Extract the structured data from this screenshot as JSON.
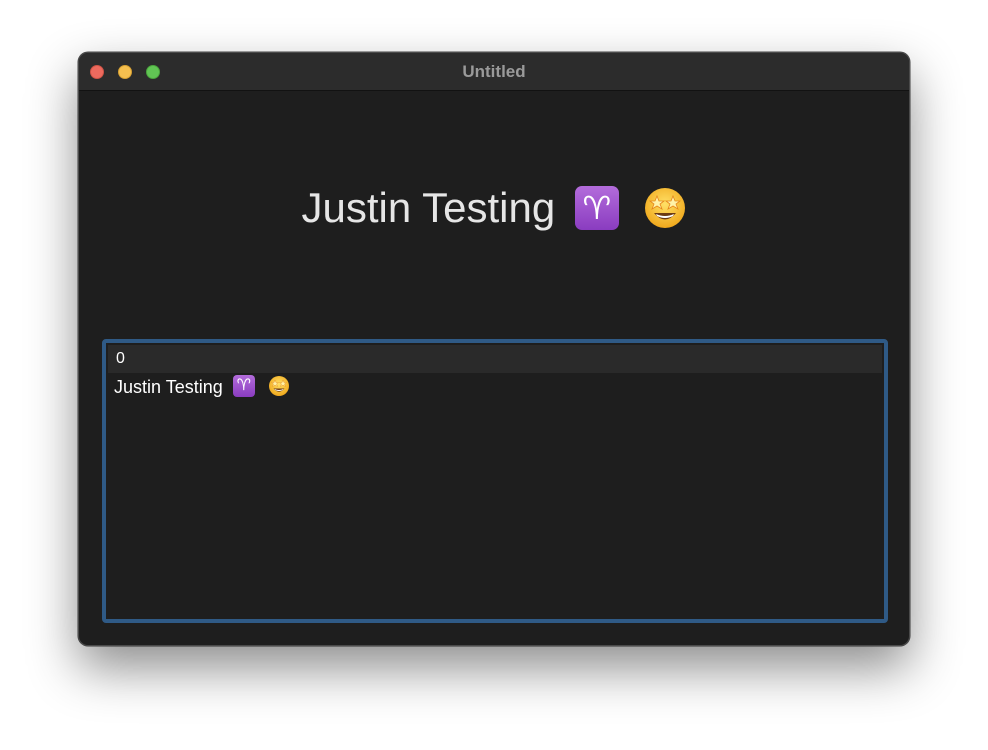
{
  "window": {
    "title": "Untitled"
  },
  "heading": {
    "text": "Justin Testing",
    "emoji_1": "aries-zodiac-icon",
    "emoji_2": "star-struck-face-icon"
  },
  "list": {
    "header": "0",
    "rows": [
      {
        "text": "Justin Testing",
        "emoji_1": "aries-zodiac-icon",
        "emoji_2": "star-struck-face-icon"
      }
    ],
    "focus_color": "#2f5a86"
  },
  "icons": {
    "aries_glyph": "♈"
  },
  "colors": {
    "close": "#ed6a5e",
    "minimize": "#f5bf4f",
    "zoom": "#61c554"
  }
}
